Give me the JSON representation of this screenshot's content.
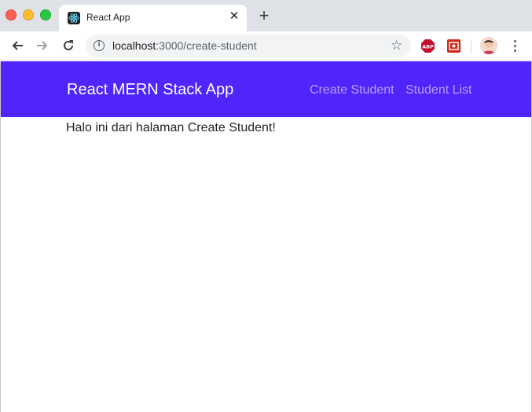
{
  "browser": {
    "tab": {
      "title": "React App",
      "close_glyph": "✕"
    },
    "new_tab_glyph": "+",
    "address": {
      "host": "localhost",
      "path": ":3000/create-student"
    },
    "extensions": [
      "adblock-plus-icon",
      "screenshot-extension-icon"
    ],
    "colors": {
      "tabstrip": "#dee1e6",
      "omnibox": "#f1f3f4"
    }
  },
  "app": {
    "brand": "React MERN Stack App",
    "nav": {
      "create_student": "Create Student",
      "student_list": "Student List"
    },
    "content": "Halo ini dari halaman Create Student!",
    "colors": {
      "navbar": "#5025fb",
      "text": "#212529"
    }
  }
}
